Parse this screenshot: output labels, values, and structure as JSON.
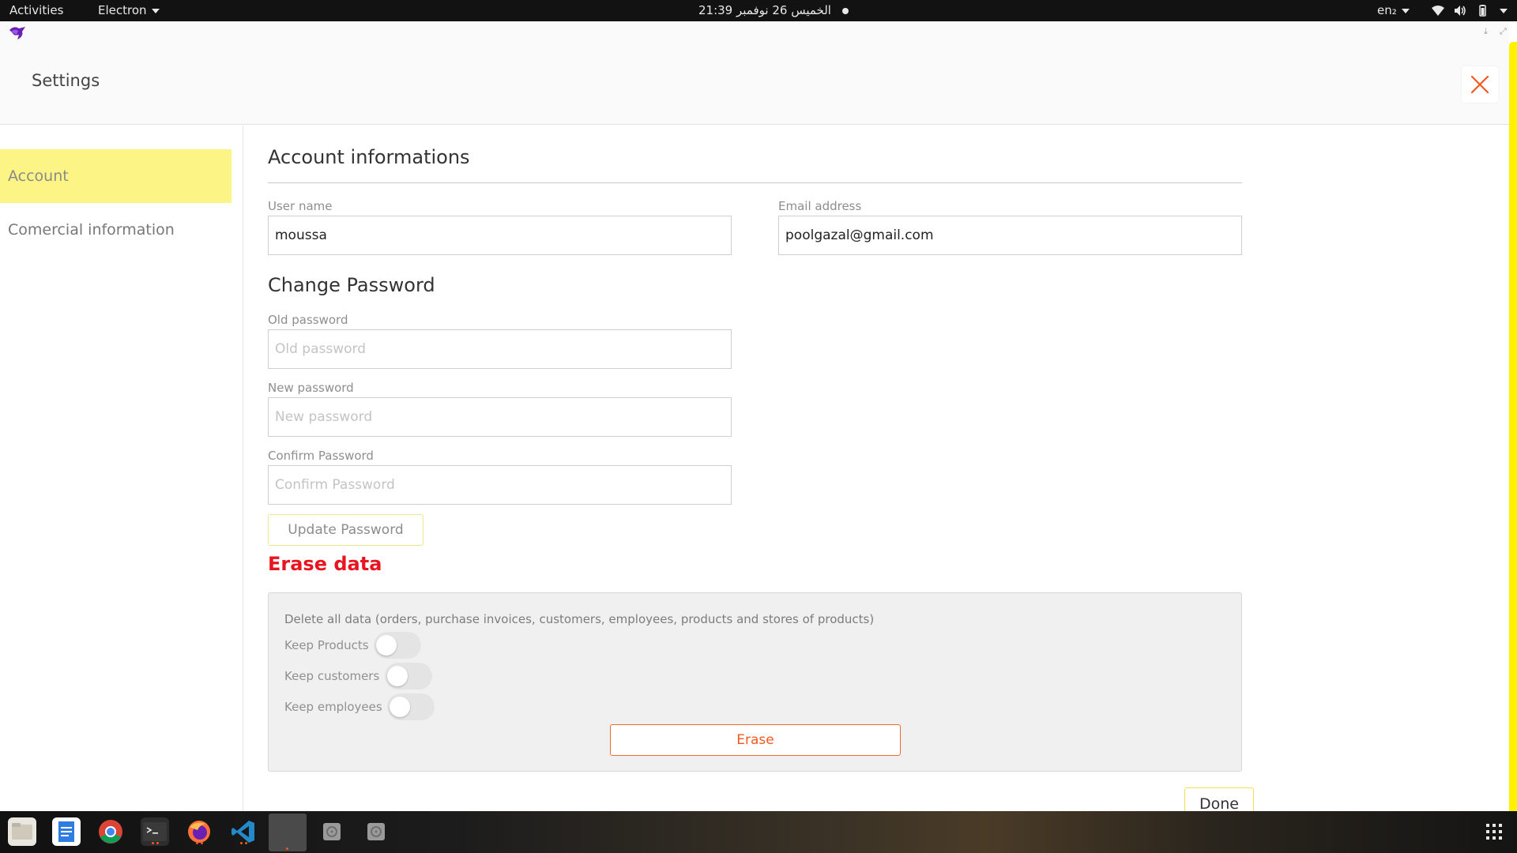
{
  "topbar": {
    "activities": "Activities",
    "app_menu": "Electron",
    "clock": "الخميس 26 نوفمبر  21:39",
    "keyboard_layout": "en₂"
  },
  "window": {
    "title": "Settings",
    "minimize_glyph": "⤓",
    "maximize_glyph": "⤢"
  },
  "sidebar": {
    "items": [
      {
        "label": "Account",
        "active": true
      },
      {
        "label": "Comercial information",
        "active": false
      }
    ]
  },
  "account": {
    "section_title": "Account informations",
    "username_label": "User name",
    "username_value": "moussa",
    "email_label": "Email address",
    "email_value": "poolgazal@gmail.com"
  },
  "password": {
    "section_title": "Change Password",
    "old_label": "Old password",
    "old_placeholder": "Old password",
    "new_label": "New password",
    "new_placeholder": "New password",
    "confirm_label": "Confirm Password",
    "confirm_placeholder": "Confirm Password",
    "update_button": "Update Password"
  },
  "erase": {
    "section_title": "Erase data",
    "description": "Delete all data (orders, purchase invoices, customers, employees, products and stores of products)",
    "toggles": [
      {
        "label": "Keep Products",
        "on": false
      },
      {
        "label": "Keep customers",
        "on": false
      },
      {
        "label": "Keep employees",
        "on": false
      }
    ],
    "erase_button": "Erase"
  },
  "footer": {
    "done_button": "Done"
  },
  "colors": {
    "accent_yellow": "#fff200",
    "active_item_bg": "#fcf484",
    "danger_red": "#e8141f",
    "erase_orange": "#f05a1f"
  },
  "dock": {
    "apps": [
      "files-icon",
      "text-editor-icon",
      "chrome-icon",
      "terminal-icon",
      "firefox-icon",
      "vscode-icon",
      "electron-app-icon",
      "disk-icon",
      "disk-icon-2",
      "app-grid-icon"
    ]
  }
}
